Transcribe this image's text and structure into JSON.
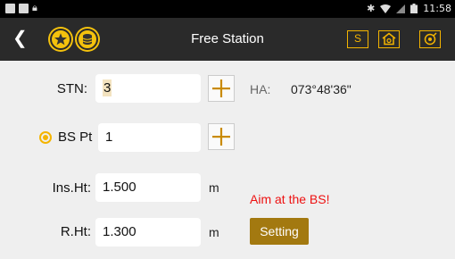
{
  "status_bar": {
    "time": "11:58",
    "icons": [
      "app-square-icon",
      "app-square-icon",
      "lock-icon",
      "bluetooth-icon",
      "wifi-icon",
      "signal-icon",
      "battery-icon"
    ]
  },
  "header": {
    "title": "Free Station",
    "back_icon": "back-chevron-icon",
    "s_button_label": "S",
    "accent_color": "#f4b400"
  },
  "form": {
    "stn_label": "STN:",
    "stn_value": "3",
    "ha_label": "HA:",
    "ha_value": "073°48'36\"",
    "bs_label": "BS Pt",
    "bs_value": "1",
    "insht_label": "Ins.Ht:",
    "insht_value": "1.500",
    "insht_unit": "m",
    "rht_label": "R.Ht:",
    "rht_value": "1.300",
    "rht_unit": "m",
    "warning": "Aim at the BS!",
    "setting_button": "Setting"
  },
  "colors": {
    "warning": "#e11111",
    "setting_bg": "#a37910"
  }
}
